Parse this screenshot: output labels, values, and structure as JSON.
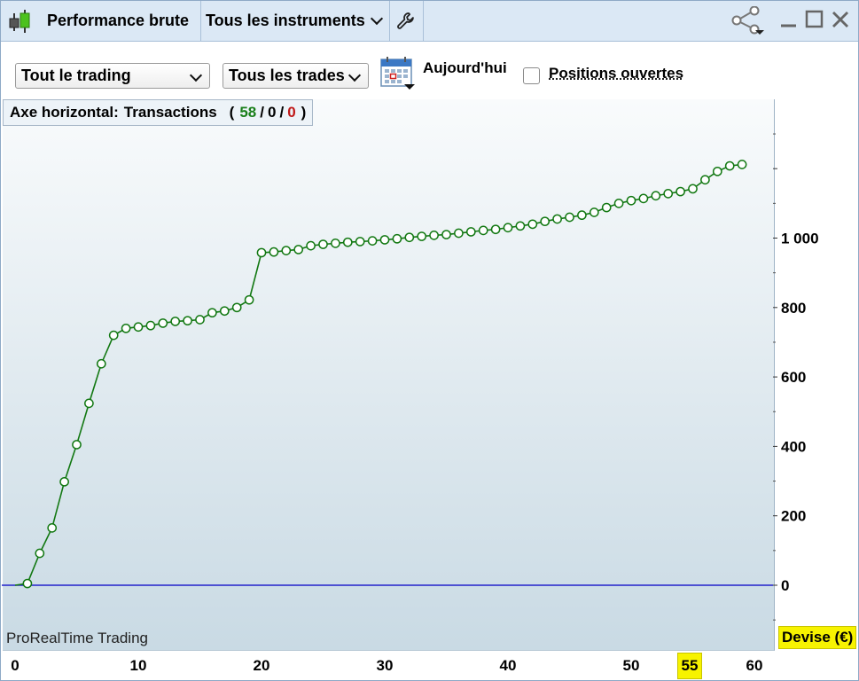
{
  "window": {
    "title": "Performance brute",
    "instruments": "Tous les instruments"
  },
  "toolbar": {
    "scope_select": "Tout le trading",
    "trades_select": "Tous les trades",
    "period_label": "Aujourd'hui",
    "open_positions_label": "Positions ouvertes",
    "open_positions_checked": false
  },
  "axis_info": {
    "prefix": "Axe horizontal:",
    "mode": "Transactions",
    "open_paren": "(",
    "count_total": "58",
    "sep1": "/",
    "count_mid": "0",
    "sep2": "/",
    "count_red": "0",
    "close_paren": ")"
  },
  "brand": "ProRealTime Trading",
  "currency_label": "Devise (€)",
  "x_cursor_label": "55",
  "colors": {
    "series": "#127812",
    "zero_line": "#2222cc",
    "highlight": "#f7f300"
  },
  "chart_data": {
    "type": "line",
    "xlabel": "",
    "ylabel": "",
    "xlim": [
      0,
      62
    ],
    "ylim": [
      -110,
      1340
    ],
    "x_ticks": [
      0,
      10,
      20,
      30,
      40,
      50,
      60
    ],
    "x_tick_labels": [
      "0",
      "10",
      "20",
      "30",
      "40",
      "50",
      "60"
    ],
    "y_ticks": [
      0,
      200,
      400,
      600,
      800,
      1000
    ],
    "y_tick_labels": [
      "0",
      "200",
      "400",
      "600",
      "800",
      "1 000"
    ],
    "zero_line": 0,
    "grid": false,
    "series": [
      {
        "values": [
          0,
          5,
          92,
          165,
          298,
          405,
          524,
          638,
          720,
          740,
          744,
          748,
          755,
          760,
          762,
          765,
          785,
          790,
          800,
          822,
          958,
          960,
          964,
          967,
          978,
          982,
          985,
          988,
          990,
          992,
          995,
          998,
          1002,
          1005,
          1008,
          1010,
          1014,
          1018,
          1022,
          1025,
          1030,
          1035,
          1040,
          1048,
          1055,
          1060,
          1066,
          1074,
          1088,
          1100,
          1108,
          1114,
          1122,
          1128,
          1134,
          1142,
          1168,
          1192,
          1208,
          1212
        ]
      }
    ]
  }
}
